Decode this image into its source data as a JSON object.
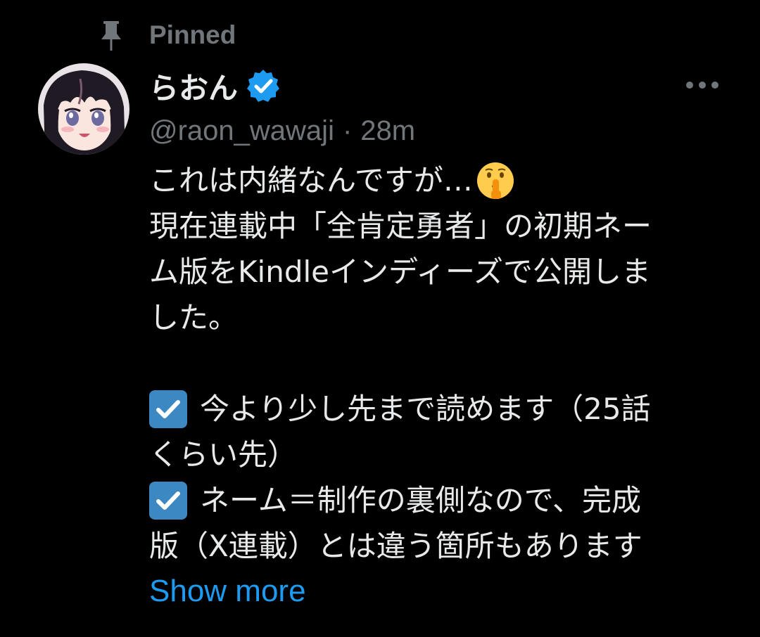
{
  "pinned": {
    "label": "Pinned",
    "icon": "pin-icon"
  },
  "author": {
    "display_name": "らおん",
    "verified_icon": "verified-badge-icon",
    "handle": "@raon_wawaji",
    "separator": "·",
    "time": "28m",
    "avatar_icon": "avatar-anime-girl"
  },
  "more_icon": "more-horizontal-icon",
  "tweet": {
    "line1": "これは内緒なんですが…",
    "line1_emoji": "shushing-face-emoji",
    "line2": "現在連載中「全肯定勇者」の初期ネー",
    "line3": "ム版をKindleインディーズで公開しま",
    "line4": "した。",
    "bullet1_line1": "今より少し先まで読めます（25話",
    "bullet1_line2": "くらい先）",
    "bullet2_line1": "ネーム＝制作の裏側なので、完成",
    "bullet2_line2": "版（X連載）とは違う箇所もあります",
    "bullet_icon": "check-box-icon"
  },
  "show_more": "Show more",
  "colors": {
    "background": "#000000",
    "text": "#e7e9ea",
    "muted": "#71767b",
    "link": "#1d9bf0",
    "verified": "#1d9bf0",
    "check_box": "#3b88c3"
  }
}
